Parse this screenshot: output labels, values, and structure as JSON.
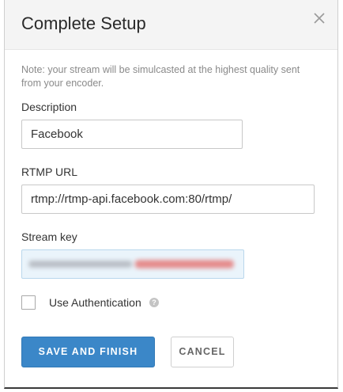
{
  "dialog": {
    "title": "Complete Setup",
    "close_icon": "close-icon"
  },
  "note": "Note: your stream will be simulcasted at the highest quality sent from your encoder.",
  "fields": {
    "description": {
      "label": "Description",
      "value": "Facebook"
    },
    "rtmp_url": {
      "label": "RTMP URL",
      "value": "rtmp://rtmp-api.facebook.com:80/rtmp/"
    },
    "stream_key": {
      "label": "Stream key"
    }
  },
  "auth": {
    "label": "Use Authentication",
    "checked": false,
    "help_icon": "question-icon",
    "help_glyph": "?"
  },
  "buttons": {
    "save": "SAVE AND FINISH",
    "cancel": "CANCEL"
  },
  "colors": {
    "primary": "#3b87c8",
    "header_bg": "#f4f4f4",
    "stream_key_bg": "#eaf4fb",
    "redaction_red": "#e58a8a"
  }
}
